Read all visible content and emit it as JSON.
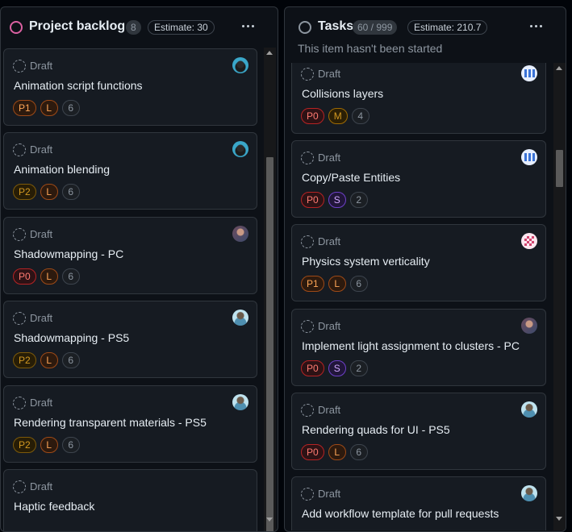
{
  "columns": [
    {
      "title": "Project backlog",
      "count": "8",
      "estimate": "Estimate: 30",
      "status_color": "#db61a2",
      "cards": [
        {
          "status": "Draft",
          "title": "Animation script functions",
          "labels": [
            "P1",
            "L",
            "6"
          ],
          "avatar": "avatar-teal"
        },
        {
          "status": "Draft",
          "title": "Animation blending",
          "labels": [
            "P2",
            "L",
            "6"
          ],
          "avatar": "avatar-teal"
        },
        {
          "status": "Draft",
          "title": "Shadowmapping - PC",
          "labels": [
            "P0",
            "L",
            "6"
          ],
          "avatar": "avatar-warm"
        },
        {
          "status": "Draft",
          "title": "Shadowmapping - PS5",
          "labels": [
            "P2",
            "L",
            "6"
          ],
          "avatar": "avatar-sky"
        },
        {
          "status": "Draft",
          "title": "Rendering transparent materials - PS5",
          "labels": [
            "P2",
            "L",
            "6"
          ],
          "avatar": "avatar-sky"
        },
        {
          "status": "Draft",
          "title": "Haptic feedback",
          "labels": [],
          "avatar": ""
        }
      ]
    },
    {
      "title": "Tasks",
      "count": "60 / 999",
      "estimate": "Estimate: 210.7",
      "status_color": "#8d96a0",
      "description": "This item hasn't been started",
      "cards": [
        {
          "status": "Draft",
          "title": "Collisions layers",
          "labels": [
            "P0",
            "M",
            "4"
          ],
          "avatar": "avatar-blue"
        },
        {
          "status": "Draft",
          "title": "Copy/Paste Entities",
          "labels": [
            "P0",
            "S",
            "2"
          ],
          "avatar": "avatar-blue"
        },
        {
          "status": "Draft",
          "title": "Physics system verticality",
          "labels": [
            "P1",
            "L",
            "6"
          ],
          "avatar": "avatar-pink"
        },
        {
          "status": "Draft",
          "title": "Implement light assignment to clusters - PC",
          "labels": [
            "P0",
            "S",
            "2"
          ],
          "avatar": "avatar-warm"
        },
        {
          "status": "Draft",
          "title": "Rendering quads for UI - PS5",
          "labels": [
            "P0",
            "L",
            "6"
          ],
          "avatar": "avatar-sky"
        },
        {
          "status": "Draft",
          "title": "Add workflow template for pull requests",
          "labels": [],
          "avatar": "avatar-sky"
        }
      ]
    }
  ],
  "label_colors": {
    "P0": {
      "text": "#ff7b72",
      "border": "#b62324",
      "bg": "#2d1215"
    },
    "P1": {
      "text": "#ffa657",
      "border": "#9e4a17",
      "bg": "#2d1a0e"
    },
    "P2": {
      "text": "#d29922",
      "border": "#7d5a0a",
      "bg": "#271d06"
    },
    "L": {
      "text": "#ffa657",
      "border": "#9e4a17",
      "bg": "#2d1a0e"
    },
    "M": {
      "text": "#d29922",
      "border": "#9e6a03",
      "bg": "#2b1f05"
    },
    "S": {
      "text": "#d2a8ff",
      "border": "#6e40c9",
      "bg": "#21163a"
    },
    "number": {
      "text": "#8d96a0",
      "border": "#3d444d",
      "bg": "#1b1f24"
    }
  }
}
